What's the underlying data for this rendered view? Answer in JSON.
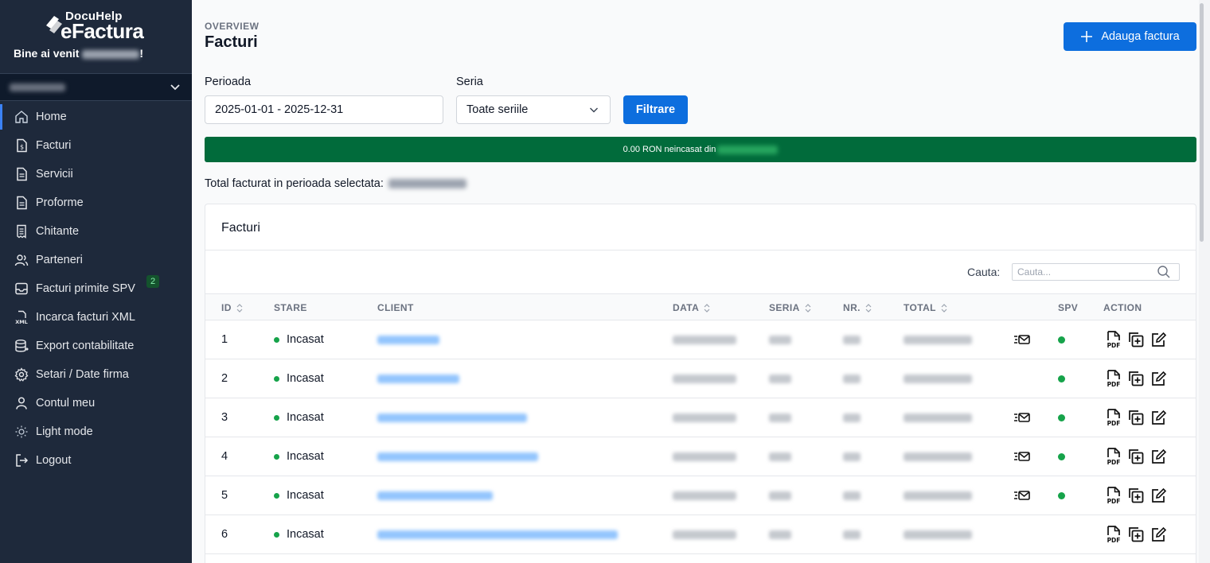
{
  "sidebar": {
    "logo_top": "DocuHelp",
    "logo_main": "eFactura",
    "welcome_prefix": "Bine ai venit",
    "welcome_suffix": "!",
    "items": [
      {
        "label": "Home",
        "icon": "home-icon"
      },
      {
        "label": "Facturi",
        "icon": "invoice-icon"
      },
      {
        "label": "Servicii",
        "icon": "document-icon"
      },
      {
        "label": "Proforme",
        "icon": "document-icon"
      },
      {
        "label": "Chitante",
        "icon": "receipt-icon"
      },
      {
        "label": "Parteneri",
        "icon": "users-icon"
      },
      {
        "label": "Facturi primite SPV",
        "icon": "inbox-icon",
        "badge": "2"
      },
      {
        "label": "Incarca facturi XML",
        "icon": "xml-icon"
      },
      {
        "label": "Export contabilitate",
        "icon": "database-icon"
      },
      {
        "label": "Setari / Date firma",
        "icon": "gear-icon"
      },
      {
        "label": "Contul meu",
        "icon": "user-icon"
      },
      {
        "label": "Light mode",
        "icon": "sun-icon"
      },
      {
        "label": "Logout",
        "icon": "logout-icon"
      }
    ]
  },
  "header": {
    "overline": "OVERVIEW",
    "title": "Facturi",
    "add_label": "Adauga factura"
  },
  "filters": {
    "period_label": "Perioada",
    "period_value": "2025-01-01 - 2025-12-31",
    "series_label": "Seria",
    "series_value": "Toate seriile",
    "filter_label": "Filtrare"
  },
  "status": {
    "text": "0.00 RON neincasat din",
    "color": "#016b3b"
  },
  "total": {
    "label": "Total facturat in perioada selectata:"
  },
  "table": {
    "title": "Facturi",
    "search_label": "Cauta:",
    "search_placeholder": "Cauta...",
    "columns": [
      "ID",
      "STARE",
      "CLIENT",
      "DATA",
      "SERIA",
      "NR.",
      "TOTAL",
      "SPV",
      "ACTION"
    ],
    "rows": [
      {
        "id": "1",
        "state": "Incasat",
        "email": true,
        "spv": true
      },
      {
        "id": "2",
        "state": "Incasat",
        "email": false,
        "spv": true
      },
      {
        "id": "3",
        "state": "Incasat",
        "email": true,
        "spv": true
      },
      {
        "id": "4",
        "state": "Incasat",
        "email": true,
        "spv": true
      },
      {
        "id": "5",
        "state": "Incasat",
        "email": true,
        "spv": true
      },
      {
        "id": "6",
        "state": "Incasat",
        "email": false,
        "spv": false
      }
    ]
  },
  "colors": {
    "accent": "#0d6ede",
    "sidebar": "#1e293b",
    "success": "#16a34a"
  }
}
